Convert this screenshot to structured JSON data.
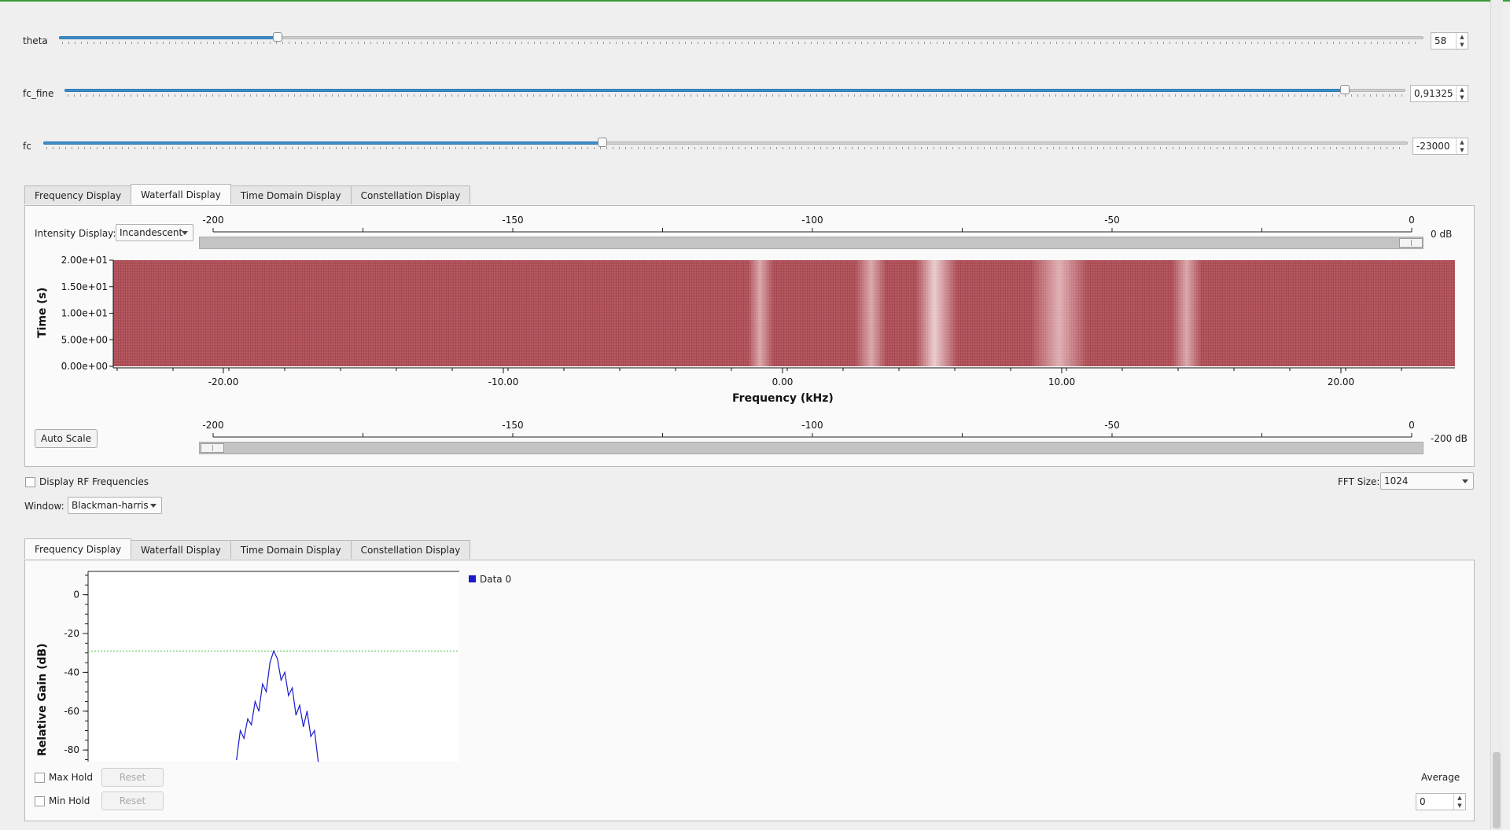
{
  "controls": [
    {
      "name": "theta",
      "value": "58",
      "fraction": 0.16
    },
    {
      "name": "fc_fine",
      "value": "0,91325",
      "fraction": 0.955
    },
    {
      "name": "fc",
      "value": "-23000",
      "fraction": 0.41
    }
  ],
  "top_tabs": [
    "Frequency Display",
    "Waterfall Display",
    "Time Domain Display",
    "Constellation Display"
  ],
  "top_active_tab": "Waterfall Display",
  "waterfall": {
    "intensity_label": "Intensity Display:",
    "intensity_value": "Incandescent",
    "scale_ticks": [
      "-200",
      "-150",
      "-100",
      "-50",
      "0"
    ],
    "max_db_label": "0 dB",
    "min_db_label": "-200 dB",
    "auto_scale": "Auto Scale",
    "ylabel": "Time (s)",
    "y_ticks": [
      "2.00e+01",
      "1.50e+01",
      "1.00e+01",
      "5.00e+00",
      "0.00e+00"
    ],
    "xlabel": "Frequency (kHz)",
    "x_ticks": [
      "-20.00",
      "-10.00",
      "0.00",
      "10.00",
      "20.00"
    ]
  },
  "display_rf": "Display RF Frequencies",
  "fft_size_label": "FFT Size:",
  "fft_size_value": "1024",
  "window_label": "Window:",
  "window_value": "Blackman-harris",
  "bottom_tabs": [
    "Frequency Display",
    "Waterfall Display",
    "Time Domain Display",
    "Constellation Display"
  ],
  "bottom_active_tab": "Frequency Display",
  "freq_plot": {
    "ylabel": "Relative Gain (dB)",
    "y_ticks": [
      "0",
      "-20",
      "-40",
      "-60",
      "-80"
    ],
    "legend": "Data 0",
    "series_color": "#1a1acc",
    "threshold_color": "#4fbf4f"
  },
  "max_hold": "Max Hold",
  "min_hold": "Min Hold",
  "reset": "Reset",
  "average_label": "Average",
  "average_value": "0",
  "chart_data": {
    "type": "line",
    "xlabel": "",
    "ylabel": "Relative Gain (dB)",
    "ylim": [
      -86,
      12
    ],
    "threshold": -29,
    "series": [
      {
        "name": "Data 0",
        "x": [
          0.4,
          0.41,
          0.42,
          0.43,
          0.44,
          0.45,
          0.46,
          0.47,
          0.48,
          0.49,
          0.5,
          0.51,
          0.52,
          0.53,
          0.54,
          0.55,
          0.56,
          0.57,
          0.58,
          0.59,
          0.6,
          0.61,
          0.62
        ],
        "values": [
          -85,
          -70,
          -74,
          -64,
          -67,
          -55,
          -60,
          -46,
          -50,
          -35,
          -29,
          -33,
          -44,
          -40,
          -52,
          -48,
          -62,
          -57,
          -68,
          -60,
          -73,
          -70,
          -86
        ]
      }
    ]
  }
}
